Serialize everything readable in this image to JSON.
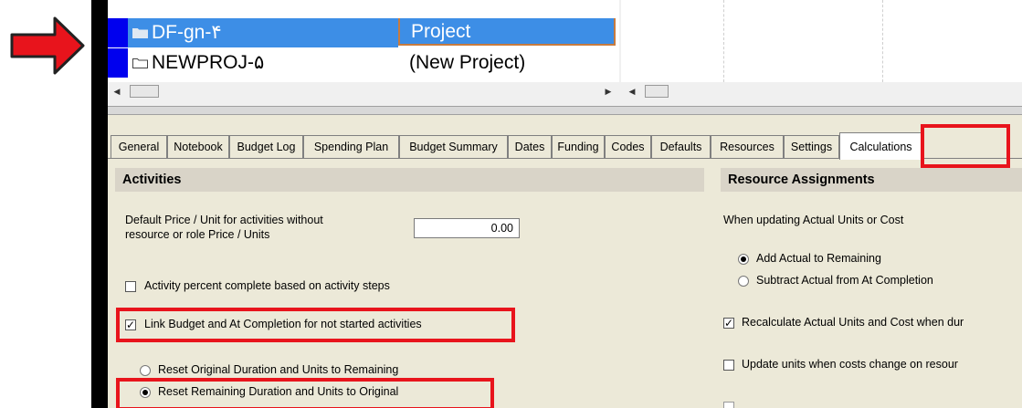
{
  "colors": {
    "arrow": "#e8141c",
    "selection": "#3d8ee6",
    "marker": "#0000ee",
    "highlight_box": "#e8141c"
  },
  "project_list": {
    "rows": [
      {
        "name": "DF-gn-۴",
        "type": "Project",
        "selected": true
      },
      {
        "name": "NEWPROJ-۵",
        "type": "(New Project)",
        "selected": false
      }
    ]
  },
  "tabs": [
    "General",
    "Notebook",
    "Budget Log",
    "Spending Plan",
    "Budget Summary",
    "Dates",
    "Funding",
    "Codes",
    "Defaults",
    "Resources",
    "Settings",
    "Calculations"
  ],
  "active_tab": "Calculations",
  "activities": {
    "title": "Activities",
    "price_label_line1": "Default Price / Unit for activities without",
    "price_label_line2": "resource or role Price / Units",
    "price_value": "0.00",
    "percent_steps_label": "Activity percent complete based on activity steps",
    "percent_steps_checked": false,
    "link_budget_label": "Link Budget and At Completion for not started activities",
    "link_budget_checked": true,
    "reset_original_label": "Reset Original Duration and Units to Remaining",
    "reset_remaining_label": "Reset Remaining Duration and Units to Original",
    "reset_selected": "reset_remaining"
  },
  "resource_assignments": {
    "title": "Resource Assignments",
    "updating_label": "When updating Actual Units or Cost",
    "add_actual_label": "Add Actual to Remaining",
    "subtract_actual_label": "Subtract Actual from At Completion",
    "selected_option": "add_actual",
    "recalculate_label": "Recalculate Actual Units and Cost when dur",
    "recalculate_checked": true,
    "update_units_label": "Update units when costs change on resour",
    "update_units_checked": false
  }
}
